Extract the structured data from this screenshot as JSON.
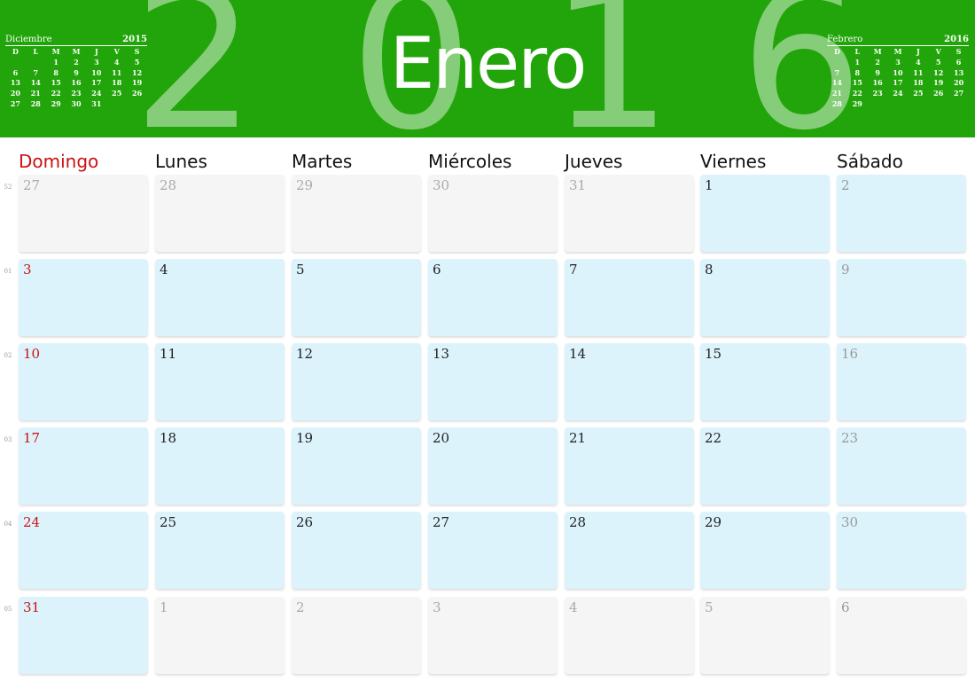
{
  "header": {
    "month": "Enero",
    "year_digits": [
      "2",
      "0",
      "1",
      "6"
    ],
    "color": "#22a50a"
  },
  "prev_month": {
    "name": "Diciembre",
    "year": "2015",
    "day_letters": [
      "D",
      "L",
      "M",
      "M",
      "J",
      "V",
      "S"
    ],
    "days": [
      "",
      "",
      "1",
      "2",
      "3",
      "4",
      "5",
      "6",
      "7",
      "8",
      "9",
      "10",
      "11",
      "12",
      "13",
      "14",
      "15",
      "16",
      "17",
      "18",
      "19",
      "20",
      "21",
      "22",
      "23",
      "24",
      "25",
      "26",
      "27",
      "28",
      "29",
      "30",
      "31",
      "",
      ""
    ]
  },
  "next_month": {
    "name": "Febrero",
    "year": "2016",
    "day_letters": [
      "D",
      "L",
      "M",
      "M",
      "J",
      "V",
      "S"
    ],
    "days": [
      "",
      "1",
      "2",
      "3",
      "4",
      "5",
      "6",
      "7",
      "8",
      "9",
      "10",
      "11",
      "12",
      "13",
      "14",
      "15",
      "16",
      "17",
      "18",
      "19",
      "20",
      "21",
      "22",
      "23",
      "24",
      "25",
      "26",
      "27",
      "28",
      "29",
      "",
      "",
      "",
      "",
      ""
    ]
  },
  "day_names": [
    "Domingo",
    "Lunes",
    "Martes",
    "Miércoles",
    "Jueves",
    "Viernes",
    "Sábado"
  ],
  "weeks": [
    {
      "week": "52",
      "days": [
        {
          "d": "27",
          "in": false
        },
        {
          "d": "28",
          "in": false
        },
        {
          "d": "29",
          "in": false
        },
        {
          "d": "30",
          "in": false
        },
        {
          "d": "31",
          "in": false
        },
        {
          "d": "1",
          "in": true
        },
        {
          "d": "2",
          "in": true
        }
      ]
    },
    {
      "week": "01",
      "days": [
        {
          "d": "3",
          "in": true
        },
        {
          "d": "4",
          "in": true
        },
        {
          "d": "5",
          "in": true
        },
        {
          "d": "6",
          "in": true
        },
        {
          "d": "7",
          "in": true
        },
        {
          "d": "8",
          "in": true
        },
        {
          "d": "9",
          "in": true
        }
      ]
    },
    {
      "week": "02",
      "days": [
        {
          "d": "10",
          "in": true
        },
        {
          "d": "11",
          "in": true
        },
        {
          "d": "12",
          "in": true
        },
        {
          "d": "13",
          "in": true
        },
        {
          "d": "14",
          "in": true
        },
        {
          "d": "15",
          "in": true
        },
        {
          "d": "16",
          "in": true
        }
      ]
    },
    {
      "week": "03",
      "days": [
        {
          "d": "17",
          "in": true
        },
        {
          "d": "18",
          "in": true
        },
        {
          "d": "19",
          "in": true
        },
        {
          "d": "20",
          "in": true
        },
        {
          "d": "21",
          "in": true
        },
        {
          "d": "22",
          "in": true
        },
        {
          "d": "23",
          "in": true
        }
      ]
    },
    {
      "week": "04",
      "days": [
        {
          "d": "24",
          "in": true
        },
        {
          "d": "25",
          "in": true
        },
        {
          "d": "26",
          "in": true
        },
        {
          "d": "27",
          "in": true
        },
        {
          "d": "28",
          "in": true
        },
        {
          "d": "29",
          "in": true
        },
        {
          "d": "30",
          "in": true
        }
      ]
    },
    {
      "week": "05",
      "days": [
        {
          "d": "31",
          "in": true
        },
        {
          "d": "1",
          "in": false
        },
        {
          "d": "2",
          "in": false
        },
        {
          "d": "3",
          "in": false
        },
        {
          "d": "4",
          "in": false
        },
        {
          "d": "5",
          "in": false
        },
        {
          "d": "6",
          "in": false
        }
      ]
    }
  ],
  "colors": {
    "sunday": "#cc1111",
    "current_cell": "#dcf3fc",
    "other_cell": "#f5f5f5"
  }
}
